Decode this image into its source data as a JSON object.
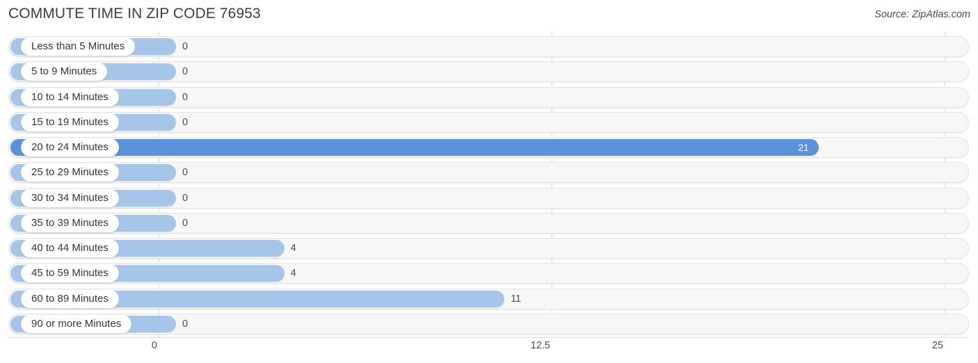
{
  "header": {
    "title": "COMMUTE TIME IN ZIP CODE 76953",
    "source": "Source: ZipAtlas.com"
  },
  "colors": {
    "bar_default": "#a6c6e9",
    "bar_highlight": "#5b92db",
    "track": "#f7f7f7",
    "track_border": "#e3e3e3",
    "gridline": "#dadada",
    "text": "#3c3c42",
    "value_inside": "#ffffff"
  },
  "chart_data": {
    "type": "bar",
    "orientation": "horizontal",
    "title": "COMMUTE TIME IN ZIP CODE 76953",
    "subtitle": "",
    "xlabel": "",
    "ylabel": "",
    "xlim": [
      0,
      25
    ],
    "grid": true,
    "legend": null,
    "source": "Source: ZipAtlas.com",
    "xticks": [
      "0",
      "12.5",
      "25"
    ],
    "xtick_values": [
      0,
      12.5,
      25
    ],
    "categories": [
      "Less than 5 Minutes",
      "5 to 9 Minutes",
      "10 to 14 Minutes",
      "15 to 19 Minutes",
      "20 to 24 Minutes",
      "25 to 29 Minutes",
      "30 to 34 Minutes",
      "35 to 39 Minutes",
      "40 to 44 Minutes",
      "45 to 59 Minutes",
      "60 to 89 Minutes",
      "90 or more Minutes"
    ],
    "values": [
      0,
      0,
      0,
      0,
      21,
      0,
      0,
      0,
      4,
      4,
      11,
      0
    ],
    "value_labels": [
      "0",
      "0",
      "0",
      "0",
      "21",
      "0",
      "0",
      "0",
      "4",
      "4",
      "11",
      "0"
    ],
    "highlight_index": 4
  },
  "rows": [
    {
      "label": "Less than 5 Minutes",
      "value": 0,
      "value_label": "0",
      "highlight": false
    },
    {
      "label": "5 to 9 Minutes",
      "value": 0,
      "value_label": "0",
      "highlight": false
    },
    {
      "label": "10 to 14 Minutes",
      "value": 0,
      "value_label": "0",
      "highlight": false
    },
    {
      "label": "15 to 19 Minutes",
      "value": 0,
      "value_label": "0",
      "highlight": false
    },
    {
      "label": "20 to 24 Minutes",
      "value": 21,
      "value_label": "21",
      "highlight": true
    },
    {
      "label": "25 to 29 Minutes",
      "value": 0,
      "value_label": "0",
      "highlight": false
    },
    {
      "label": "30 to 34 Minutes",
      "value": 0,
      "value_label": "0",
      "highlight": false
    },
    {
      "label": "35 to 39 Minutes",
      "value": 0,
      "value_label": "0",
      "highlight": false
    },
    {
      "label": "40 to 44 Minutes",
      "value": 4,
      "value_label": "4",
      "highlight": false
    },
    {
      "label": "45 to 59 Minutes",
      "value": 4,
      "value_label": "4",
      "highlight": false
    },
    {
      "label": "60 to 89 Minutes",
      "value": 11,
      "value_label": "11",
      "highlight": false
    },
    {
      "label": "90 or more Minutes",
      "value": 0,
      "value_label": "0",
      "highlight": false
    }
  ],
  "axis": {
    "ticks": [
      {
        "label": "0",
        "value": 0
      },
      {
        "label": "12.5",
        "value": 12.5
      },
      {
        "label": "25",
        "value": 25
      }
    ]
  }
}
